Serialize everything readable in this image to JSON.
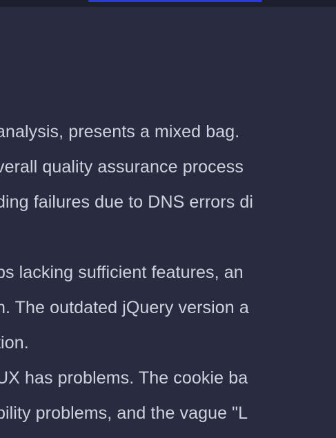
{
  "content": {
    "paragraph_1": [
      " analysis, presents a mixed bag.",
      "verall quality assurance process",
      "ding failures due to DNS errors di"
    ],
    "paragraph_2": [
      "ps lacking sufficient features, an",
      "n. The outdated jQuery version a",
      "tion."
    ],
    "paragraph_3": [
      "UX has problems. The cookie ba",
      "bility problems, and the vague \"L"
    ]
  },
  "colors": {
    "background": "#292c40",
    "top_bar": "#1d1f2e",
    "link_accent": "#2f37d6",
    "text": "#cfd1dd"
  }
}
